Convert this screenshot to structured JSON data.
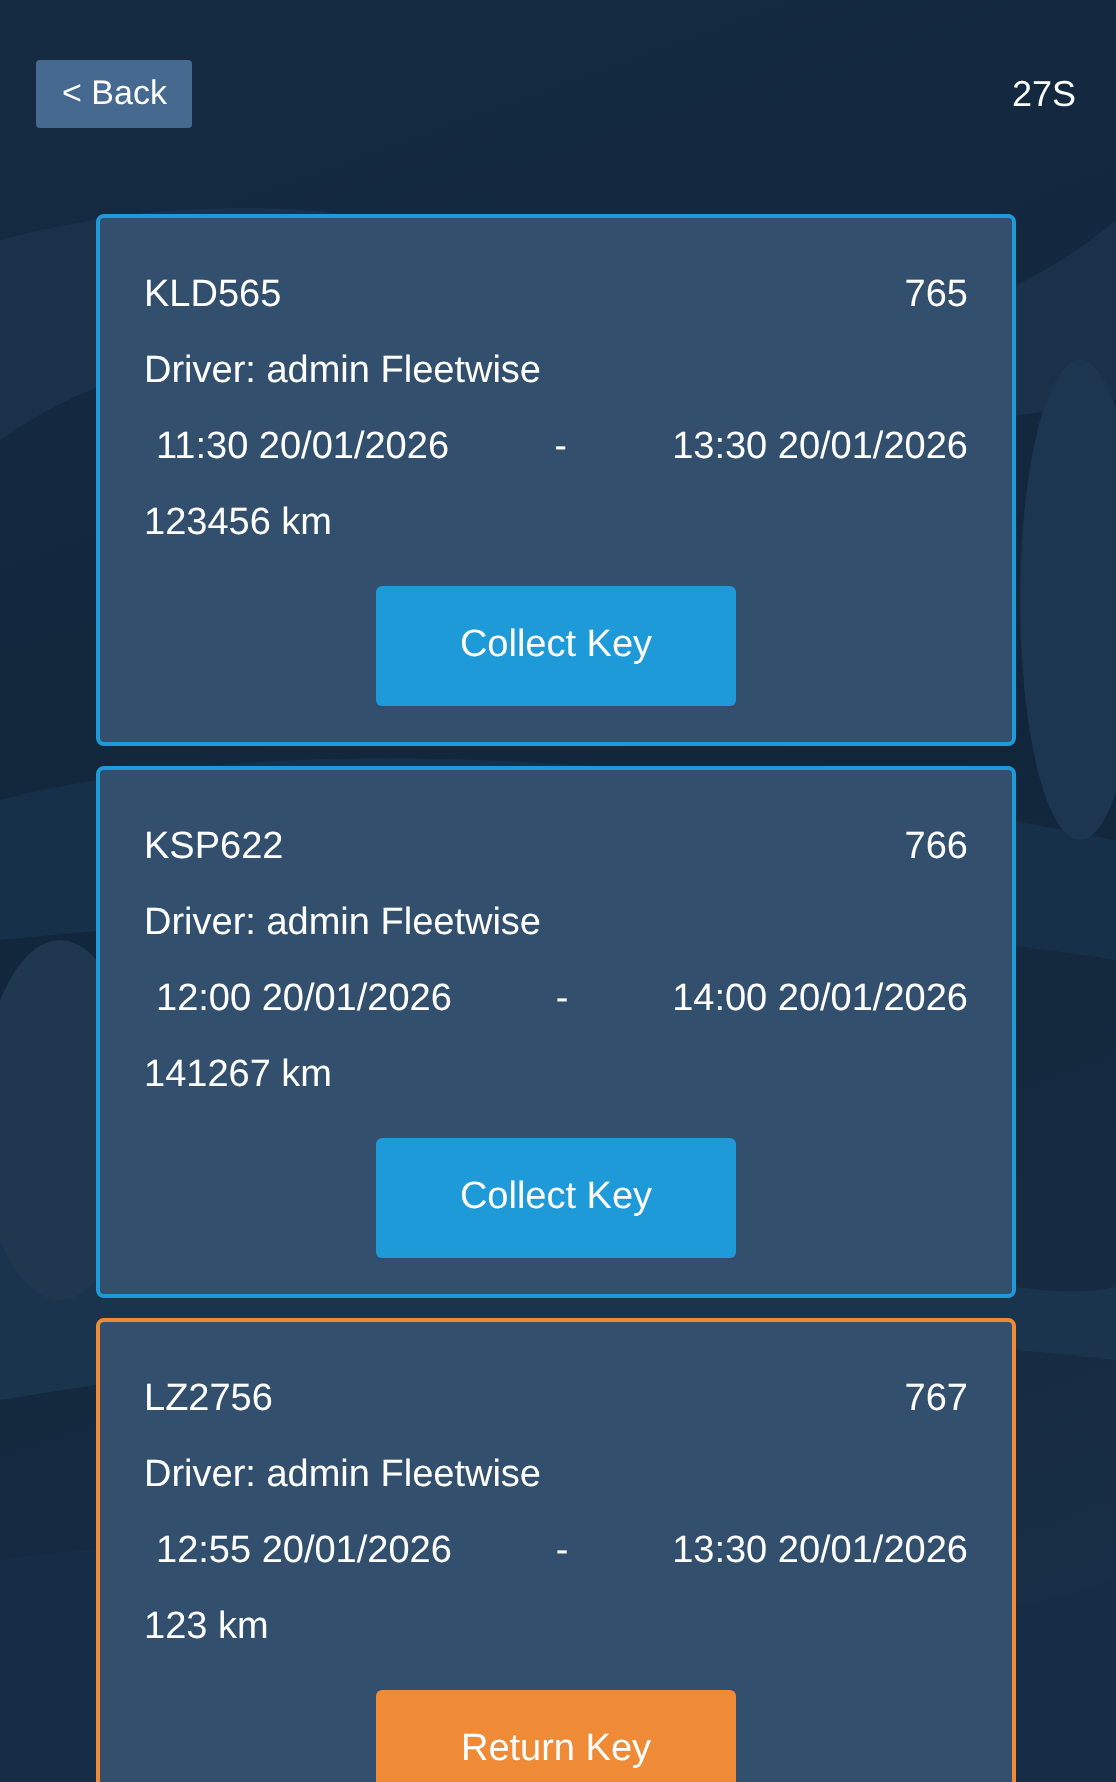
{
  "back_button": {
    "label": "< Back"
  },
  "header_code": "27S",
  "bookings": [
    {
      "kind": "collect",
      "plate": "KLD565",
      "number": "765",
      "driver": "Driver: admin Fleetwise",
      "start": "11:30 20/01/2026",
      "separator": "-",
      "end": "13:30 20/01/2026",
      "mileage": "123456 km",
      "action": "Collect Key"
    },
    {
      "kind": "collect",
      "plate": "KSP622",
      "number": "766",
      "driver": "Driver: admin Fleetwise",
      "start": "12:00 20/01/2026",
      "separator": "-",
      "end": "14:00 20/01/2026",
      "mileage": "141267 km",
      "action": "Collect Key"
    },
    {
      "kind": "return",
      "plate": "LZ2756",
      "number": "767",
      "driver": "Driver: admin Fleetwise",
      "start": "12:55 20/01/2026",
      "separator": "-",
      "end": "13:30 20/01/2026",
      "mileage": "123 km",
      "action": "Return Key"
    }
  ]
}
